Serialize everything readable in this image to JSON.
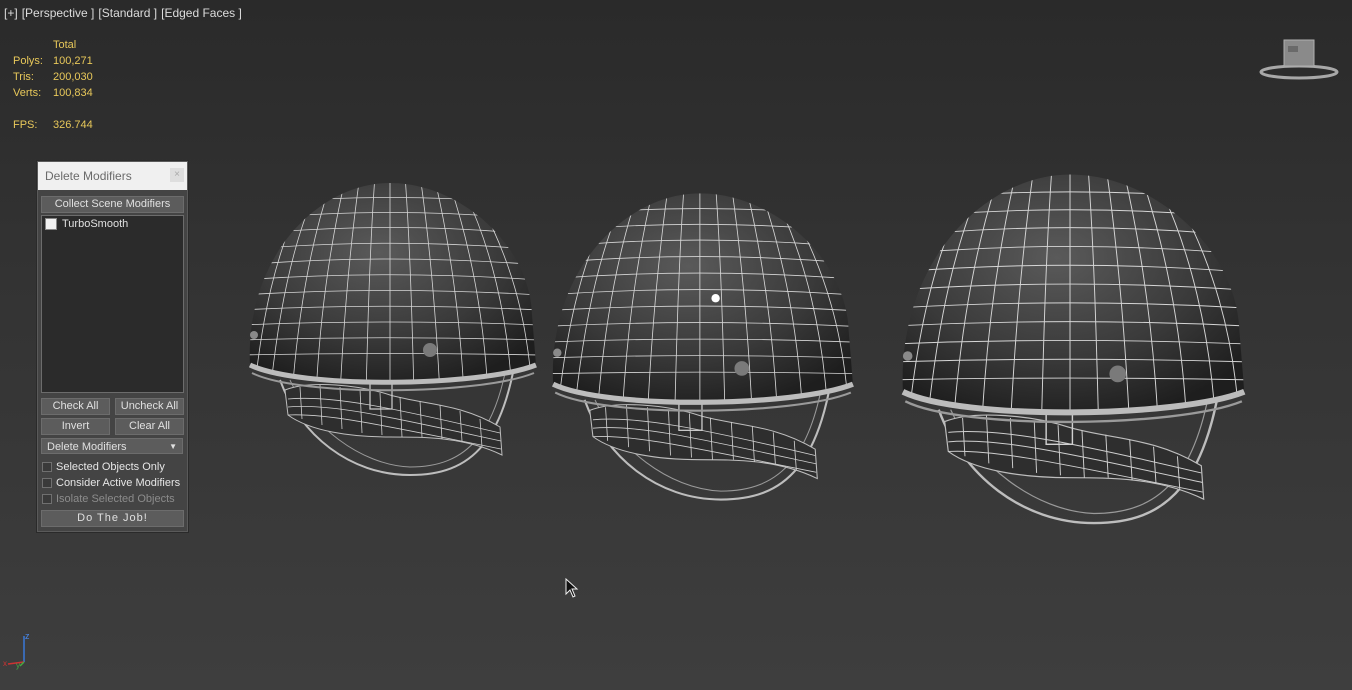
{
  "viewport": {
    "labels": [
      "[+]",
      "[Perspective ]",
      "[Standard ]",
      "[Edged Faces ]"
    ]
  },
  "stats": {
    "header": "Total",
    "polys_label": "Polys:",
    "polys": "100,271",
    "tris_label": "Tris:",
    "tris": "200,030",
    "verts_label": "Verts:",
    "verts": "100,834",
    "fps_label": "FPS:",
    "fps": "326.744"
  },
  "dialog": {
    "title": "Delete Modifiers",
    "close": "×",
    "collect_button": "Collect Scene Modifiers",
    "list_items": [
      "TurboSmooth"
    ],
    "check_all": "Check All",
    "uncheck_all": "Uncheck All",
    "invert": "Invert",
    "clear_all": "Clear All",
    "dropdown_value": "Delete Modifiers",
    "options": {
      "selected_only": "Selected Objects Only",
      "consider_active": "Consider Active Modifiers",
      "isolate_selected": "Isolate Selected Objects"
    },
    "do_job": "Do The Job!"
  },
  "icons": {
    "viewcube": "viewcube-icon",
    "axis": "axis-tripod-icon",
    "cursor": "mouse-cursor-icon"
  },
  "colors": {
    "stats_text": "#e8c85a",
    "wire": "#d8d8d8",
    "background_top": "#2a2a2a",
    "background_bottom": "#3e3e3e"
  }
}
